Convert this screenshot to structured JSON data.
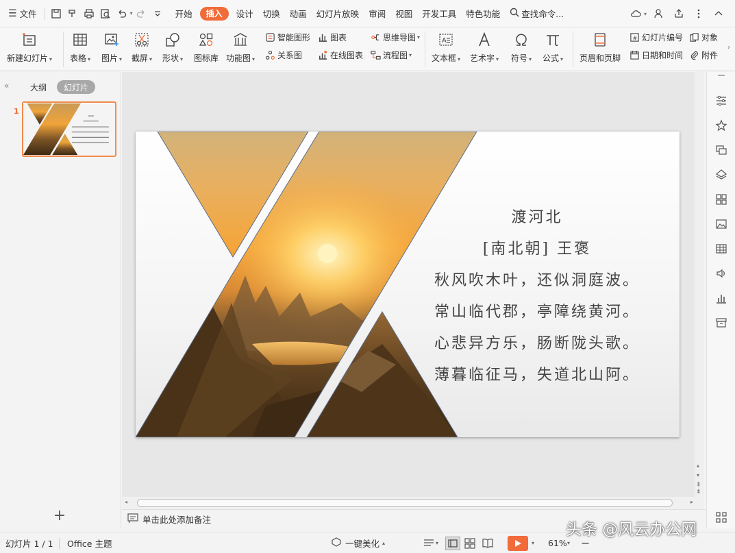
{
  "topbar": {
    "file_menu": "文件",
    "tabs": [
      "开始",
      "插入",
      "设计",
      "切换",
      "动画",
      "幻灯片放映",
      "审阅",
      "视图",
      "开发工具",
      "特色功能"
    ],
    "active_tab": "插入",
    "search": "查找命令..."
  },
  "ribbon": {
    "new_slide": "新建幻灯片",
    "table": "表格",
    "picture": "图片",
    "screenshot": "截屏",
    "shape": "形状",
    "icon_lib": "图标库",
    "func_chart": "功能图",
    "smart_graphic": "智能图形",
    "chart": "图表",
    "mindmap": "思维导图",
    "relation": "关系图",
    "online_chart": "在线图表",
    "flowchart": "流程图",
    "textbox": "文本框",
    "wordart": "艺术字",
    "symbol": "符号",
    "formula": "公式",
    "header_footer": "页眉和页脚",
    "slide_number": "幻灯片编号",
    "object": "对象",
    "date_time": "日期和时间",
    "attachment": "附件"
  },
  "left_panel": {
    "tab_outline": "大纲",
    "tab_slides": "幻灯片",
    "slide_index": "1"
  },
  "slide": {
    "poem": [
      "渡河北",
      "[南北朝] 王褒",
      "秋风吹木叶，还似洞庭波。",
      "常山临代郡，亭障绕黄河。",
      "心悲异方乐，肠断陇头歌。",
      "薄暮临征马，失道北山阿。"
    ]
  },
  "notes": {
    "placeholder": "单击此处添加备注"
  },
  "statusbar": {
    "slide_counter": "幻灯片 1 / 1",
    "theme": "Office 主题",
    "beautify": "一键美化",
    "zoom": "61%"
  },
  "watermark": "头条 @风云办公网",
  "colors": {
    "accent": "#f26b3a",
    "thumb_border": "#f08a4b"
  }
}
